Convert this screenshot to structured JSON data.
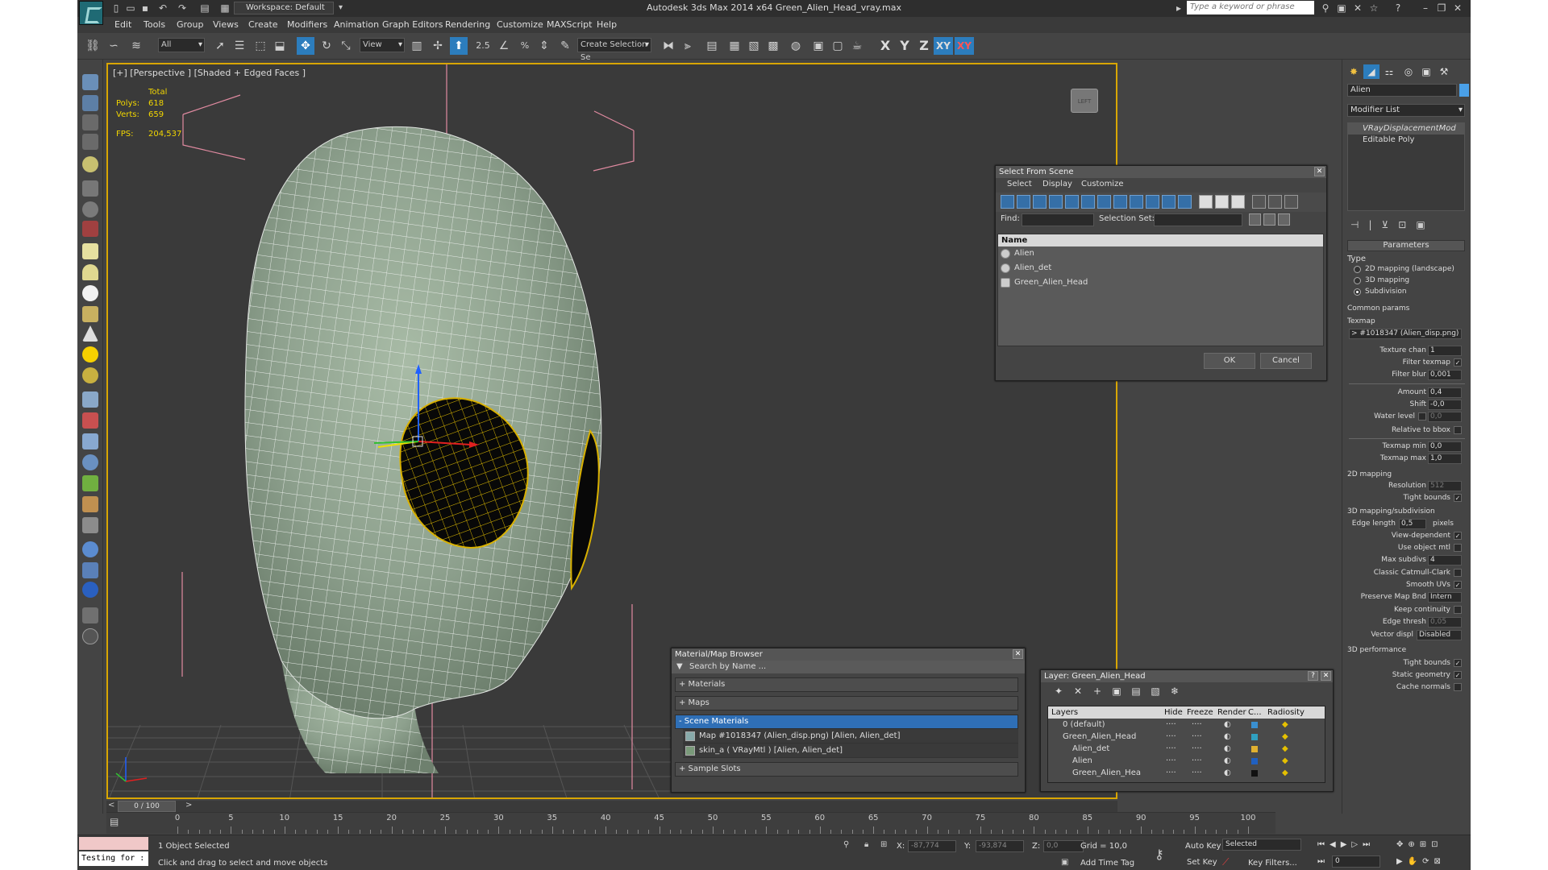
{
  "window": {
    "title": "Autodesk 3ds Max  2014 x64     Green_Alien_Head_vray.max",
    "workspace": "Workspace: Default",
    "search_placeholder": "Type a keyword or phrase"
  },
  "menu": [
    "Edit",
    "Tools",
    "Group",
    "Views",
    "Create",
    "Modifiers",
    "Animation",
    "Graph Editors",
    "Rendering",
    "Customize",
    "MAXScript",
    "Help"
  ],
  "toolbar": {
    "filter_select": "All",
    "ref_coord": "View",
    "snap_value": "2.5",
    "selection_set": "Create Selection Se",
    "axis": [
      "X",
      "Y",
      "Z",
      "XY",
      "XY"
    ]
  },
  "viewport": {
    "label": "[+] [Perspective ] [Shaded + Edged Faces ]",
    "stats": {
      "total_label": "Total",
      "polys_label": "Polys:",
      "polys": "618",
      "verts_label": "Verts:",
      "verts": "659",
      "fps_label": "FPS:",
      "fps": "204,537"
    },
    "viewcube_label": "LEFT"
  },
  "select_from_scene": {
    "title": "Select From Scene",
    "menus": [
      "Select",
      "Display",
      "Customize"
    ],
    "find_label": "Find:",
    "selection_set_label": "Selection Set:",
    "column": "Name",
    "objects": [
      "Alien",
      "Alien_det",
      "Green_Alien_Head"
    ],
    "ok": "OK",
    "cancel": "Cancel"
  },
  "material_browser": {
    "title": "Material/Map Browser",
    "search_placeholder": "Search by Name ...",
    "sections": [
      "+ Materials",
      "+ Maps",
      "- Scene Materials"
    ],
    "items": [
      "Map #1018347 (Alien_disp.png)  [Alien, Alien_det]",
      "skin_a  ( VRayMtl )  [Alien, Alien_det]"
    ],
    "footer": "+ Sample Slots"
  },
  "layer_manager": {
    "title": "Layer: Green_Alien_Head",
    "help": "?",
    "columns": [
      "Layers",
      "Hide",
      "Freeze",
      "Render",
      "C...",
      "Radiosity"
    ],
    "rows": [
      {
        "name": "0 (default)",
        "color": "#3a8fd0"
      },
      {
        "name": "Green_Alien_Head",
        "color": "#30a0c0"
      },
      {
        "name": "Alien_det",
        "color": "#e0b030"
      },
      {
        "name": "Alien",
        "color": "#2060c0"
      },
      {
        "name": "Green_Alien_Hea",
        "color": "#111111"
      }
    ]
  },
  "command_panel": {
    "object_name": "Alien",
    "modifier_list": "Modifier List",
    "stack": [
      "VRayDisplacementMod",
      "Editable Poly"
    ],
    "parameters": "Parameters",
    "type_label": "Type",
    "types": [
      "2D mapping (landscape)",
      "3D mapping",
      "Subdivision"
    ],
    "common": "Common params",
    "texmap_label": "Texmap",
    "texmap_value": "> #1018347 (Alien_disp.png)",
    "rows": [
      {
        "label": "Texture chan",
        "value": "1"
      },
      {
        "label": "Filter texmap",
        "check": "✓"
      },
      {
        "label": "Filter blur",
        "value": "0,001"
      },
      {
        "label": "Amount",
        "value": "0,4"
      },
      {
        "label": "Shift",
        "value": "-0,0"
      },
      {
        "label": "Water level",
        "value": "0,0"
      },
      {
        "label": "Relative to bbox",
        "check": ""
      },
      {
        "label": "Texmap min",
        "value": "0,0"
      },
      {
        "label": "Texmap max",
        "value": "1,0"
      }
    ],
    "mapping_2d": "2D mapping",
    "resolution_label": "Resolution",
    "resolution": "512",
    "tight_bounds": "Tight bounds",
    "mapping_3d": "3D mapping/subdivision",
    "edge_length_label": "Edge length",
    "edge_length": "0,5",
    "pixels": "pixels",
    "view_dependent": "View-dependent",
    "use_object_mtl": "Use object mtl",
    "max_subdivs_label": "Max subdivs",
    "max_subdivs": "4",
    "classic": "Classic Catmull-Clark",
    "smooth_uvs": "Smooth UVs",
    "preserve_label": "Preserve Map Bnd",
    "preserve_value": "Intern",
    "keep_continuity": "Keep continuity",
    "edge_thresh_label": "Edge thresh",
    "edge_thresh": "0,05",
    "vector_label": "Vector displ",
    "vector_value": "Disabled",
    "perf": "3D performance",
    "perf_items": [
      "Tight bounds",
      "Static geometry",
      "Cache normals"
    ]
  },
  "timeline": {
    "frame": "0 / 100",
    "ticks": [
      "0",
      "5",
      "10",
      "15",
      "20",
      "25",
      "30",
      "35",
      "40",
      "45",
      "50",
      "55",
      "60",
      "65",
      "70",
      "75",
      "80",
      "85",
      "90",
      "95",
      "100"
    ]
  },
  "status": {
    "maxscript": "Testing for :",
    "selection": "1 Object Selected",
    "prompt": "Click and drag to select and move objects",
    "x_label": "X:",
    "x": "-87,774",
    "y_label": "Y:",
    "y": "-93,874",
    "z_label": "Z:",
    "z": "0,0",
    "grid": "Grid = 10,0",
    "add_time_tag": "Add Time Tag",
    "auto_key": "Auto Key",
    "set_key": "Set Key",
    "selected": "Selected",
    "key_filters": "Key Filters...",
    "frame_field": "0"
  }
}
